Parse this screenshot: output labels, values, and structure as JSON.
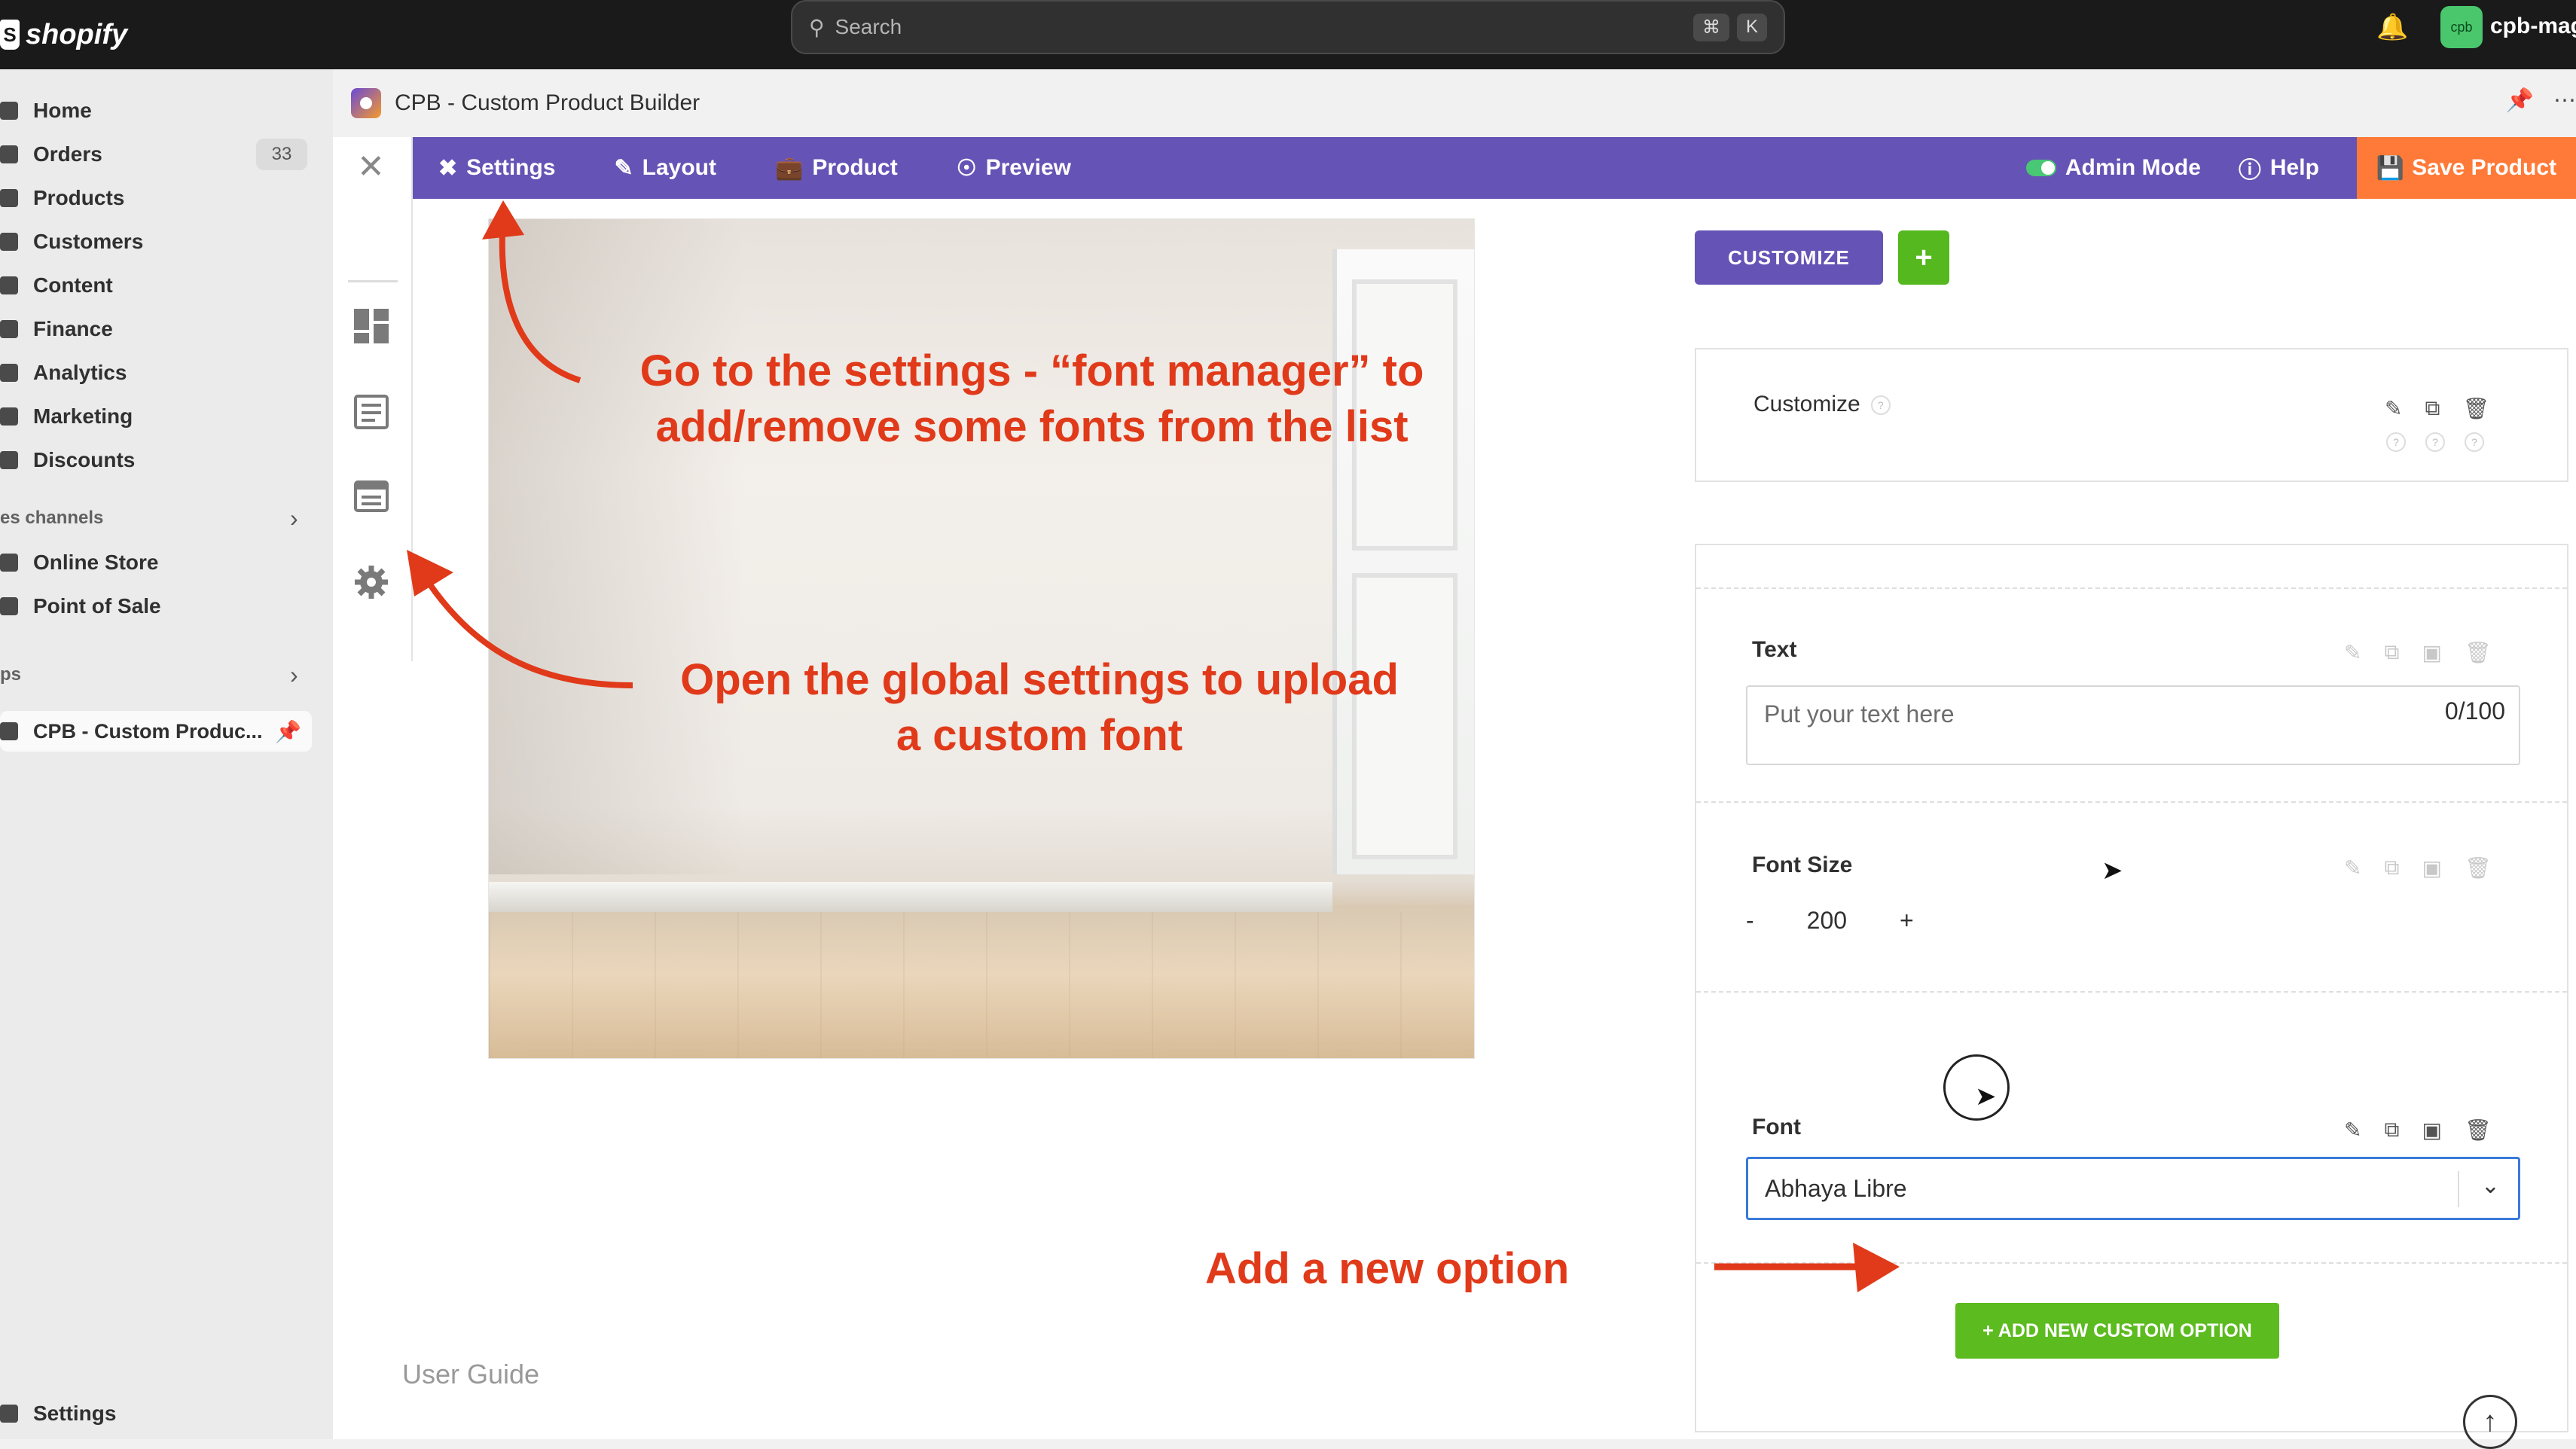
{
  "topbar": {
    "brand": "shopify",
    "search_placeholder": "Search",
    "shortcut_keys": [
      "⌘",
      "K"
    ],
    "account_initials": "cpb",
    "account_name": "cpb-mag"
  },
  "sidebar": {
    "items": [
      {
        "label": "Home"
      },
      {
        "label": "Orders",
        "badge": "33"
      },
      {
        "label": "Products"
      },
      {
        "label": "Customers"
      },
      {
        "label": "Content"
      },
      {
        "label": "Finance"
      },
      {
        "label": "Analytics"
      },
      {
        "label": "Marketing"
      },
      {
        "label": "Discounts"
      }
    ],
    "sales_channels_label": "es channels",
    "channels": [
      {
        "label": "Online Store"
      },
      {
        "label": "Point of Sale"
      }
    ],
    "apps_label": "ps",
    "active_app": "CPB - Custom Produc...",
    "settings_label": "Settings"
  },
  "app": {
    "title": "CPB - Custom Product Builder",
    "tabs": [
      {
        "label": "Settings",
        "icon": "tools-icon"
      },
      {
        "label": "Layout",
        "icon": "brush-icon"
      },
      {
        "label": "Product",
        "icon": "bag-icon"
      },
      {
        "label": "Preview",
        "icon": "eye-icon"
      }
    ],
    "admin_mode_label": "Admin Mode",
    "help_label": "Help",
    "save_label": "Save Product",
    "user_guide": "User Guide"
  },
  "builder": {
    "customize_button": "CUSTOMIZE",
    "plus_button": "+",
    "customize_card_label": "Customize",
    "text_label": "Text",
    "text_placeholder": "Put your text here",
    "text_counter": "0/100",
    "font_size_label": "Font Size",
    "font_size_minus": "-",
    "font_size_value": "200",
    "font_size_plus": "+",
    "font_label": "Font",
    "font_value": "Abhaya Libre",
    "add_option_button": "+ ADD NEW CUSTOM OPTION"
  },
  "annotations": {
    "settings_note_line1": "Go to the settings - “font manager” to",
    "settings_note_line2": "add/remove some fonts from the list",
    "global_note_line1": "Open the global settings to upload",
    "global_note_line2": "a custom font",
    "add_option_note": "Add a new option"
  },
  "colors": {
    "toolbar": "#6554b5",
    "save": "#ff7a38",
    "green": "#5cbb1f",
    "annotation": "#e03a1a"
  }
}
